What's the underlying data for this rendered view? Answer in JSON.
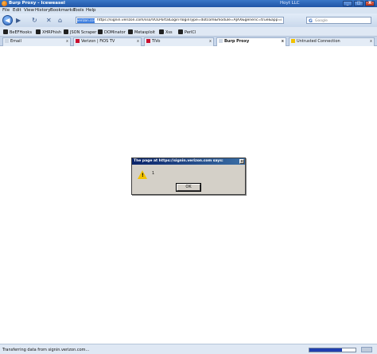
{
  "window": {
    "title": "Burp Proxy - Iceweasel",
    "holder": "Hoyt LLC",
    "controls": {
      "minimize": "_",
      "maximize": "□",
      "close": "X"
    }
  },
  "menu": [
    "File",
    "Edit",
    "View",
    "History",
    "Bookmarks",
    "Tools",
    "Help"
  ],
  "nav": {
    "back_icon": "◀",
    "forward_icon": "▶",
    "reload_icon": "↻",
    "stop_icon": "✕",
    "home_icon": "⌂",
    "identity_label": "verizon.com",
    "url": "https://signin.verizon.com/sso/VOLPortalLogin?loginType=dotcom&module=AJAX&generic=true&app=myv",
    "search_engine_icon": "G",
    "search_placeholder": "Google"
  },
  "bookmarks": [
    "BeEFHooks",
    "XHRPhish",
    "JSON Scraper",
    "DOMinator",
    "Metasploit",
    "Xss",
    "PerlCl"
  ],
  "tabs": [
    {
      "label": "Email",
      "fav_color": "#cfd8e4"
    },
    {
      "label": "Verizon | FiOS TV",
      "fav_color": "#c8102e"
    },
    {
      "label": "TiVo",
      "fav_color": "#c8102e"
    },
    {
      "label": "Burp Proxy",
      "fav_color": "#cfd8e4"
    },
    {
      "label": "Untrusted Connection",
      "fav_color": "#f2c200"
    }
  ],
  "tab_close": "x",
  "dialog": {
    "title": "The page at https://signin.verizon.com says:",
    "icon": "!",
    "message": "1",
    "ok": "OK",
    "close": "x"
  },
  "status": {
    "text": "Transferring data from signin.verizon.com...",
    "progress": 0.7
  },
  "colors": {
    "titlebar": "#2a63b5",
    "dialog_title": "#0a246a",
    "warning": "#f2c200"
  }
}
